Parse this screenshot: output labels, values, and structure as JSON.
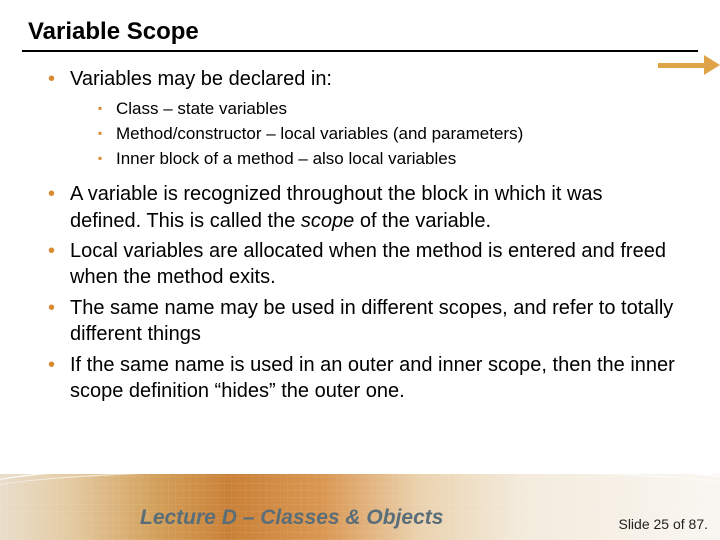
{
  "title": "Variable Scope",
  "bullets": [
    {
      "text": "Variables may be declared in:",
      "sub": [
        "Class – state variables",
        "Method/constructor – local variables (and parameters)",
        "Inner block of a method – also local variables"
      ]
    },
    {
      "html": "A variable is recognized throughout the block in which it was defined.  This is called the <span class=\"em\">scope</span> of the variable."
    },
    {
      "text": "Local variables are allocated when the method is entered and freed when the method exits."
    },
    {
      "text": "The same name may be used in different scopes, and refer to totally different things"
    },
    {
      "text": "If the same name is used in an outer and inner scope, then the inner scope definition “hides” the outer one."
    }
  ],
  "footer": {
    "lecture": "Lecture D – Classes & Objects",
    "slide_label": "Slide 25 of 87."
  },
  "colors": {
    "accent": "#d78a2e"
  }
}
